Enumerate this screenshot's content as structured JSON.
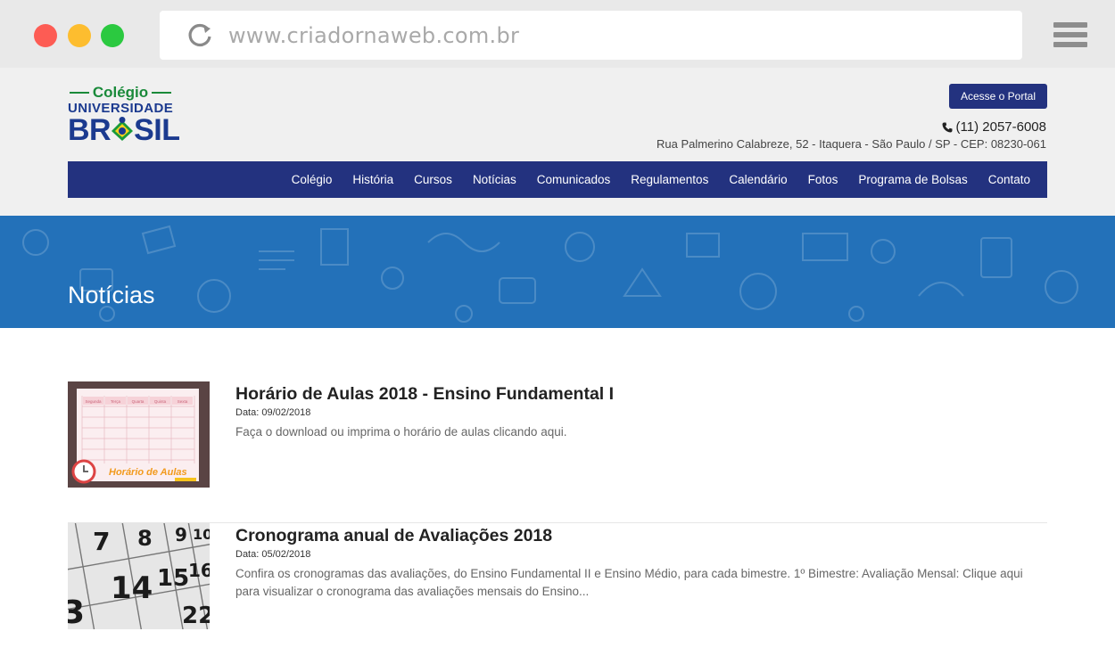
{
  "browser": {
    "url": "www.criadornaweb.com.br"
  },
  "header": {
    "logo_top": "Colégio",
    "logo_middle": "UNIVERSIDADE",
    "logo_bottom_left": "BR",
    "logo_bottom_right": "SIL",
    "portal_button": "Acesse o Portal",
    "phone": "(11) 2057-6008",
    "address": "Rua Palmerino Calabreze, 52 - Itaquera - São Paulo / SP - CEP: 08230-061"
  },
  "nav": {
    "items": [
      "Colégio",
      "História",
      "Cursos",
      "Notícias",
      "Comunicados",
      "Regulamentos",
      "Calendário",
      "Fotos",
      "Programa de Bolsas",
      "Contato"
    ]
  },
  "banner": {
    "title": "Notícias"
  },
  "news": [
    {
      "title": "Horário de Aulas 2018 - Ensino Fundamental I",
      "date": "Data: 09/02/2018",
      "description": "Faça o download ou imprima o horário de aulas clicando aqui.",
      "thumb_caption": "Horário de Aulas",
      "thumb_headers": [
        "Segunda",
        "Terça",
        "Quarta",
        "Quinta",
        "Sexta"
      ]
    },
    {
      "title": "Cronograma anual de Avaliações 2018",
      "date": "Data: 05/02/2018",
      "description": "Confira os cronogramas das avaliações, do Ensino Fundamental II e Ensino Médio, para cada bimestre.   1º Bimestre: Avaliação Mensal: Clique aqui para visualizar o cronograma das avaliações mensais do Ensino...",
      "thumb_numbers": [
        "7",
        "8",
        "9",
        "10",
        "14",
        "15",
        "16",
        "3",
        "22"
      ]
    }
  ],
  "colors": {
    "nav_bg": "#23327f",
    "banner_bg": "#2371b9",
    "header_bg": "#f0f0f0"
  }
}
